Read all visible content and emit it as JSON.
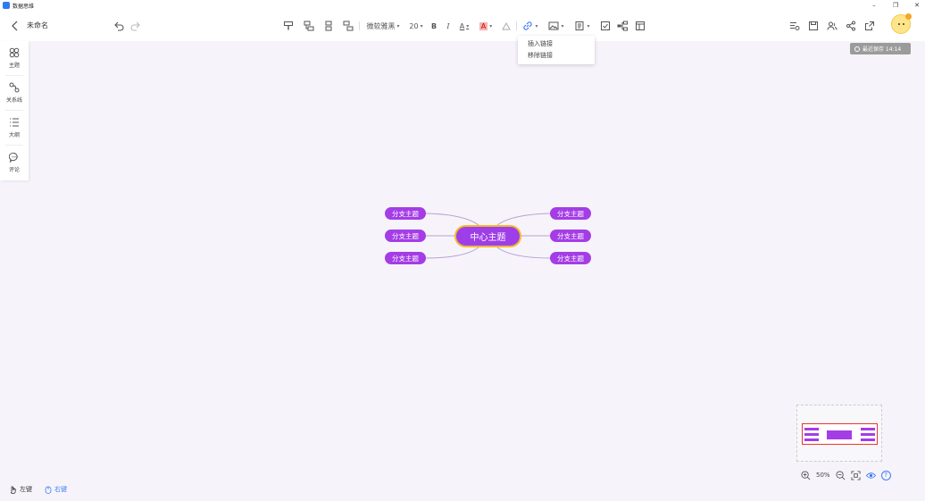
{
  "window": {
    "app_title": "数据思维",
    "min_btn": "–",
    "max_btn": "❐",
    "close_btn": "✕"
  },
  "toolbar": {
    "doc_title": "未命名",
    "font_family": "微软雅黑",
    "font_size": "20",
    "bold": "B",
    "italic": "I",
    "font_color_glyph": "A",
    "bg_color_glyph": "A",
    "caret": "▾"
  },
  "link_menu": {
    "items": [
      "插入链接",
      "移除链接"
    ]
  },
  "save_status": "最近保存 14:14",
  "sidebar": {
    "items": [
      {
        "label": "主题",
        "icon": "theme-icon"
      },
      {
        "label": "关系线",
        "icon": "relation-icon"
      },
      {
        "label": "大纲",
        "icon": "outline-icon"
      },
      {
        "label": "评论",
        "icon": "comment-icon"
      }
    ]
  },
  "mindmap": {
    "root": "中心主题",
    "branches": [
      "分支主题",
      "分支主题",
      "分支主题",
      "分支主题",
      "分支主题",
      "分支主题"
    ],
    "colors": {
      "node": "#a43de6",
      "root_border": "#f5b82e",
      "line": "#b9a1d6"
    }
  },
  "zoom": {
    "level": "50%",
    "help": "?"
  },
  "mouse_mode": {
    "left": "左键",
    "right": "右键"
  }
}
